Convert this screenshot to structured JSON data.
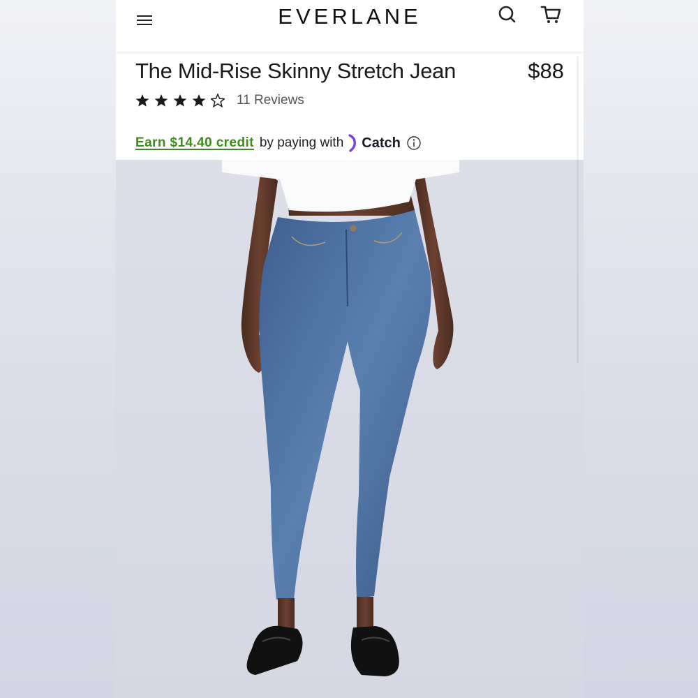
{
  "header": {
    "brand": "EVERLANE",
    "menu_icon": "hamburger-menu-icon",
    "search_icon": "search-icon",
    "cart_icon": "cart-icon"
  },
  "product": {
    "title": "The Mid-Rise Skinny Stretch Jean",
    "price": "$88",
    "rating": 4.5,
    "rating_max": 5,
    "reviews_label": "11 Reviews"
  },
  "credit": {
    "link_text": "Earn $14.40 credit",
    "suffix_text": "by paying with",
    "provider": "Catch",
    "info_icon": "info-icon",
    "link_color": "#3f8a1d"
  },
  "image": {
    "subject": "model-wearing-skinny-jeans",
    "jean_color": "#4a6fa0",
    "background_color": "#d8dbe6"
  }
}
